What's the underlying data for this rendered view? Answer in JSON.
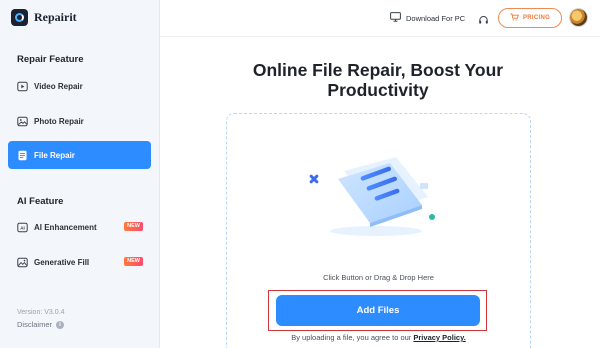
{
  "app": {
    "name": "Repairit"
  },
  "sidebar": {
    "repair_section": "Repair Feature",
    "repair_items": [
      {
        "label": "Video Repair",
        "icon": "play-icon",
        "active": false
      },
      {
        "label": "Photo Repair",
        "icon": "image-icon",
        "active": false
      },
      {
        "label": "File Repair",
        "icon": "document-icon",
        "active": true
      }
    ],
    "ai_section": "AI Feature",
    "ai_items": [
      {
        "label": "AI Enhancement",
        "icon": "ai-icon",
        "badge": "NEW"
      },
      {
        "label": "Generative Fill",
        "icon": "image-fill-icon",
        "badge": "NEW"
      }
    ],
    "version": "Version: V3.0.4",
    "disclaimer": "Disclaimer"
  },
  "header": {
    "download_label": "Download For PC",
    "pricing_label": "PRICING"
  },
  "main": {
    "title": "Online File Repair, Boost Your Productivity",
    "hint": "Click Button or Drag & Drop Here",
    "add_button": "Add Files",
    "agree_prefix": "By uploading a file, you agree to our",
    "agree_link": "Privacy Policy."
  },
  "colors": {
    "accent": "#2d8cff",
    "pricing": "#f0743a",
    "highlight_outline": "#d0343b",
    "badge": "#ff5a5a"
  }
}
